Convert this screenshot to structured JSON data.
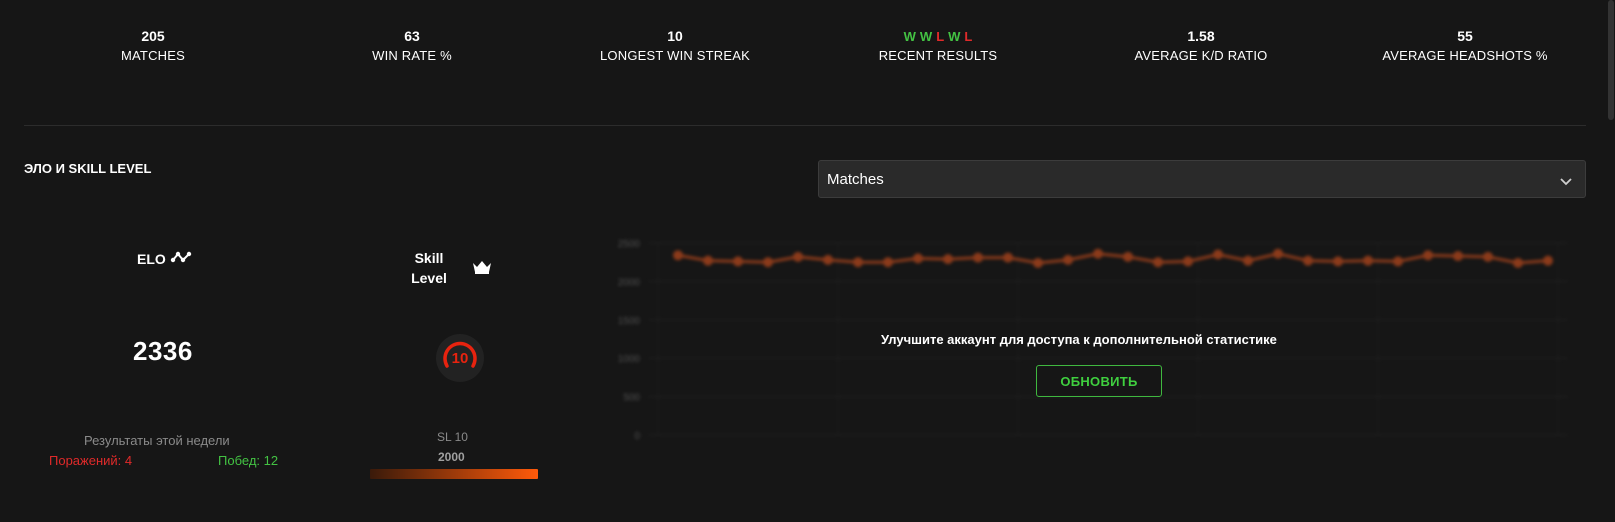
{
  "stats": [
    {
      "value": "205",
      "label": "MATCHES"
    },
    {
      "value": "63",
      "label": "WIN RATE %"
    },
    {
      "value": "10",
      "label": "LONGEST WIN STREAK"
    },
    {
      "value": "",
      "label": "RECENT RESULTS"
    },
    {
      "value": "1.58",
      "label": "AVERAGE K/D RATIO"
    },
    {
      "value": "55",
      "label": "AVERAGE HEADSHOTS %"
    }
  ],
  "recent_results": [
    "W",
    "W",
    "L",
    "W",
    "L"
  ],
  "colors": {
    "win": "#43c243",
    "loss": "#e02a2a",
    "accent": "#ff5a0a",
    "line": "#d9531e"
  },
  "section_title": "ЭЛО И SKILL LEVEL",
  "dropdown": {
    "value": "Matches",
    "icon": "chevron-down-icon"
  },
  "elo": {
    "label": "ELO",
    "value": "2336",
    "icon": "trend-icon"
  },
  "skill": {
    "label": "Skill Level",
    "level": "10",
    "icon": "crown-icon"
  },
  "week": {
    "title": "Результаты этой недели",
    "losses": "Поражений: 4",
    "wins": "Побед: 12"
  },
  "sl": {
    "label": "SL 10",
    "value": "2000",
    "progress": 1.0
  },
  "upgrade": {
    "text": "Улучшите аккаунт для доступа к дополнительной статистике",
    "button": "ОБНОВИТЬ"
  },
  "chart_data": {
    "type": "line",
    "ylim": [
      0,
      2500
    ],
    "y_ticks": [
      "0",
      "500",
      "1000",
      "1500",
      "2000",
      "2500"
    ],
    "values": [
      2340,
      2270,
      2260,
      2250,
      2320,
      2280,
      2250,
      2250,
      2300,
      2290,
      2310,
      2310,
      2240,
      2280,
      2360,
      2320,
      2250,
      2260,
      2350,
      2270,
      2360,
      2270,
      2260,
      2270,
      2260,
      2340,
      2330,
      2320,
      2240,
      2270
    ],
    "grid": true
  }
}
